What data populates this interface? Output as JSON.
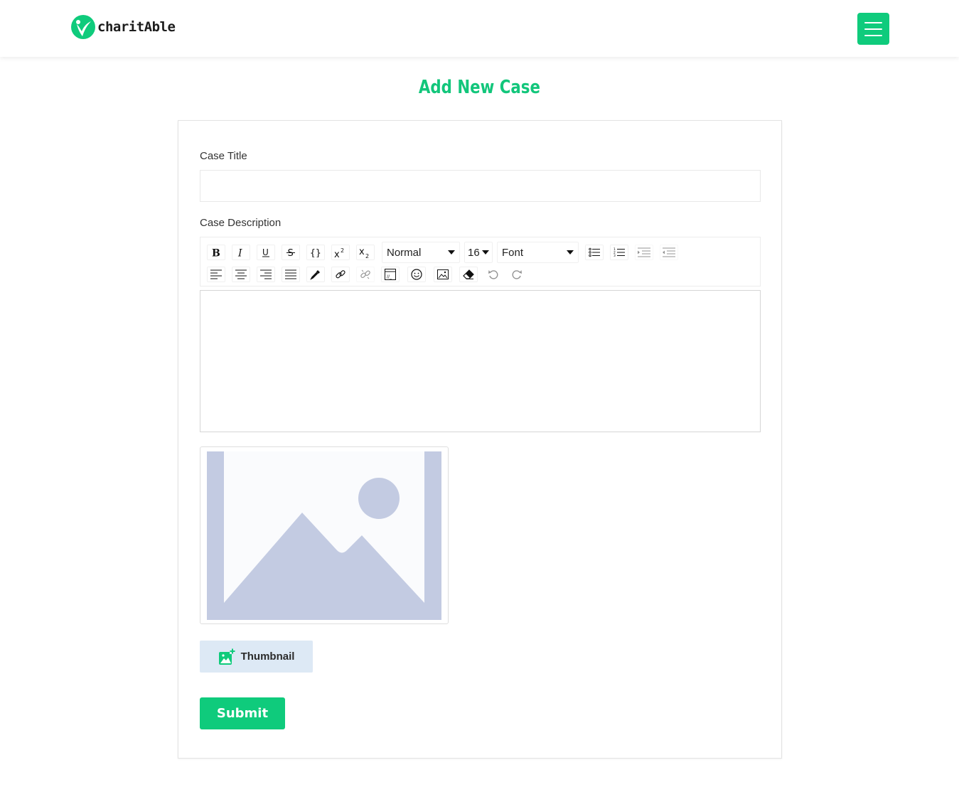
{
  "header": {
    "brand": "charitAble",
    "menu_icon": "hamburger-menu-icon",
    "accent_color": "#0fcb7c"
  },
  "page": {
    "title": "Add New Case"
  },
  "form": {
    "case_title_label": "Case Title",
    "case_title_value": "",
    "case_description_label": "Case Description",
    "editor_content": "",
    "toolbar": {
      "paragraph_style": "Normal",
      "font_size": "16",
      "font_family": "Font",
      "buttons_row1": [
        "bold",
        "italic",
        "underline",
        "strikethrough",
        "code",
        "superscript",
        "subscript",
        "unordered-list",
        "ordered-list",
        "indent",
        "outdent"
      ],
      "buttons_row2": [
        "align-left",
        "align-center",
        "align-right",
        "align-justify",
        "color-picker",
        "link",
        "unlink",
        "embedded",
        "emoji",
        "image",
        "remove-formatting",
        "undo",
        "redo"
      ]
    },
    "thumbnail_button_label": "Thumbnail",
    "submit_label": "Submit"
  }
}
